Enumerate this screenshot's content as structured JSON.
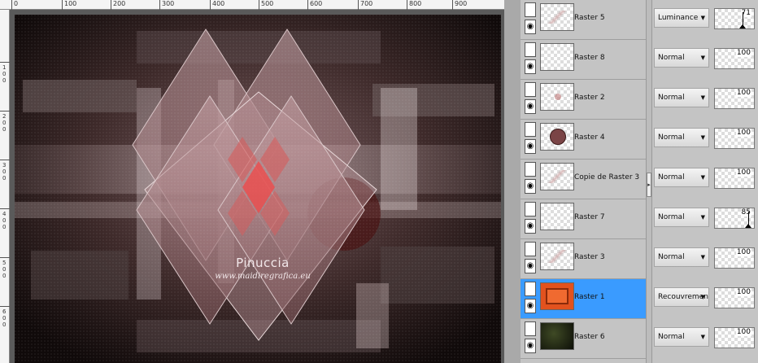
{
  "ruler": {
    "top_labels": [
      "0",
      "100",
      "200",
      "300",
      "400",
      "500",
      "600",
      "700",
      "800",
      "900"
    ],
    "left_labels": [
      "1\n0\n0",
      "2\n0\n0",
      "3\n0\n0",
      "4\n0\n0",
      "5\n0\n0",
      "6\n0\n0"
    ]
  },
  "watermark": {
    "title": "Pinuccia",
    "url": "www.maidiregrafica.eu"
  },
  "colors": {
    "selected": "#3a9bff",
    "panel": "#c4c4c4"
  },
  "layers": [
    {
      "name": "Raster 5",
      "blend": "Luminance",
      "opacity": "71",
      "selected": false,
      "thumb": "streaks"
    },
    {
      "name": "Raster 8",
      "blend": "Normal",
      "opacity": "100",
      "selected": false,
      "thumb": "empty"
    },
    {
      "name": "Raster 2",
      "blend": "Normal",
      "opacity": "100",
      "selected": false,
      "thumb": "dot"
    },
    {
      "name": "Raster 4",
      "blend": "Normal",
      "opacity": "100",
      "selected": false,
      "thumb": "circle"
    },
    {
      "name": "Copie de Raster 3",
      "blend": "Normal",
      "opacity": "100",
      "selected": false,
      "thumb": "faint"
    },
    {
      "name": "Raster 7",
      "blend": "Normal",
      "opacity": "85",
      "selected": false,
      "thumb": "empty"
    },
    {
      "name": "Raster 3",
      "blend": "Normal",
      "opacity": "100",
      "selected": false,
      "thumb": "faint"
    },
    {
      "name": "Raster 1",
      "blend": "Recouvrement",
      "opacity": "100",
      "selected": true,
      "thumb": "orange"
    },
    {
      "name": "Raster 6",
      "blend": "Normal",
      "opacity": "100",
      "selected": false,
      "thumb": "dark"
    }
  ]
}
